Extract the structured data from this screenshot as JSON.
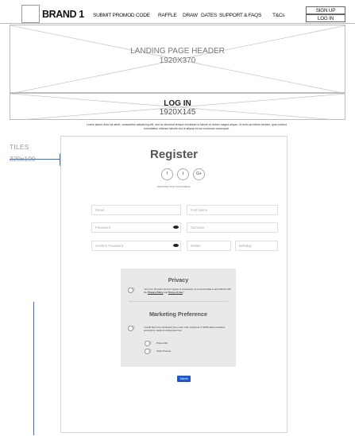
{
  "nav": {
    "brand": "BRAND 1",
    "links": [
      "SUBMIT PROMOD CODE",
      "RAFFLE",
      "DRAW",
      "DATES",
      "SUPPORT & FAQS",
      "T&Cs"
    ],
    "sign_up": "SIGN UP",
    "log_in": "LOG  IN"
  },
  "hero": {
    "title": "LANDING PAGE HEADER",
    "size": "1920X370"
  },
  "login_banner": {
    "title": "LOG IN",
    "size": "1920X145"
  },
  "intro_text": "Lorem ipsum dolor sit amet, consectetur adipiscing elit, sed do eiusmod tempor incididunt ut labore et dolore magna aliqua. Ut enim ad minim veniam, quis nostrud exercitation ullamco laboris nisi ut aliquip ex ea commodo consequat.",
  "annotation": {
    "label": "TILES",
    "size": "320x100"
  },
  "register": {
    "title": "Register",
    "social_icons": [
      "f",
      "t",
      "G+"
    ],
    "social_caption": "REGISTER WITH SOCIALMEDIA",
    "fields": {
      "email": "Email",
      "first_name": "First Name",
      "password": "Password",
      "surname": "Surname",
      "confirm_password": "Confirm Password",
      "mobile": "Mobile",
      "birthday": "Birthday"
    },
    "privacy": {
      "title": "Privacy",
      "text_before": "I am over 18 years old and I agree to processing my personal data in accordance with the ",
      "privacy_link": "Privacy Policy",
      "text_and": " and ",
      "terms_link": "Terms of Use",
      "text_after": ".*"
    },
    "marketing": {
      "title": "Marketing Preference",
      "text": "I would like to be contacted (via e-mail, mail, telephone or SMS) about exclusive promotions, deals and discounts from:",
      "options": [
        "Promo 001",
        "Other Promos"
      ]
    },
    "submit": "Submit"
  }
}
